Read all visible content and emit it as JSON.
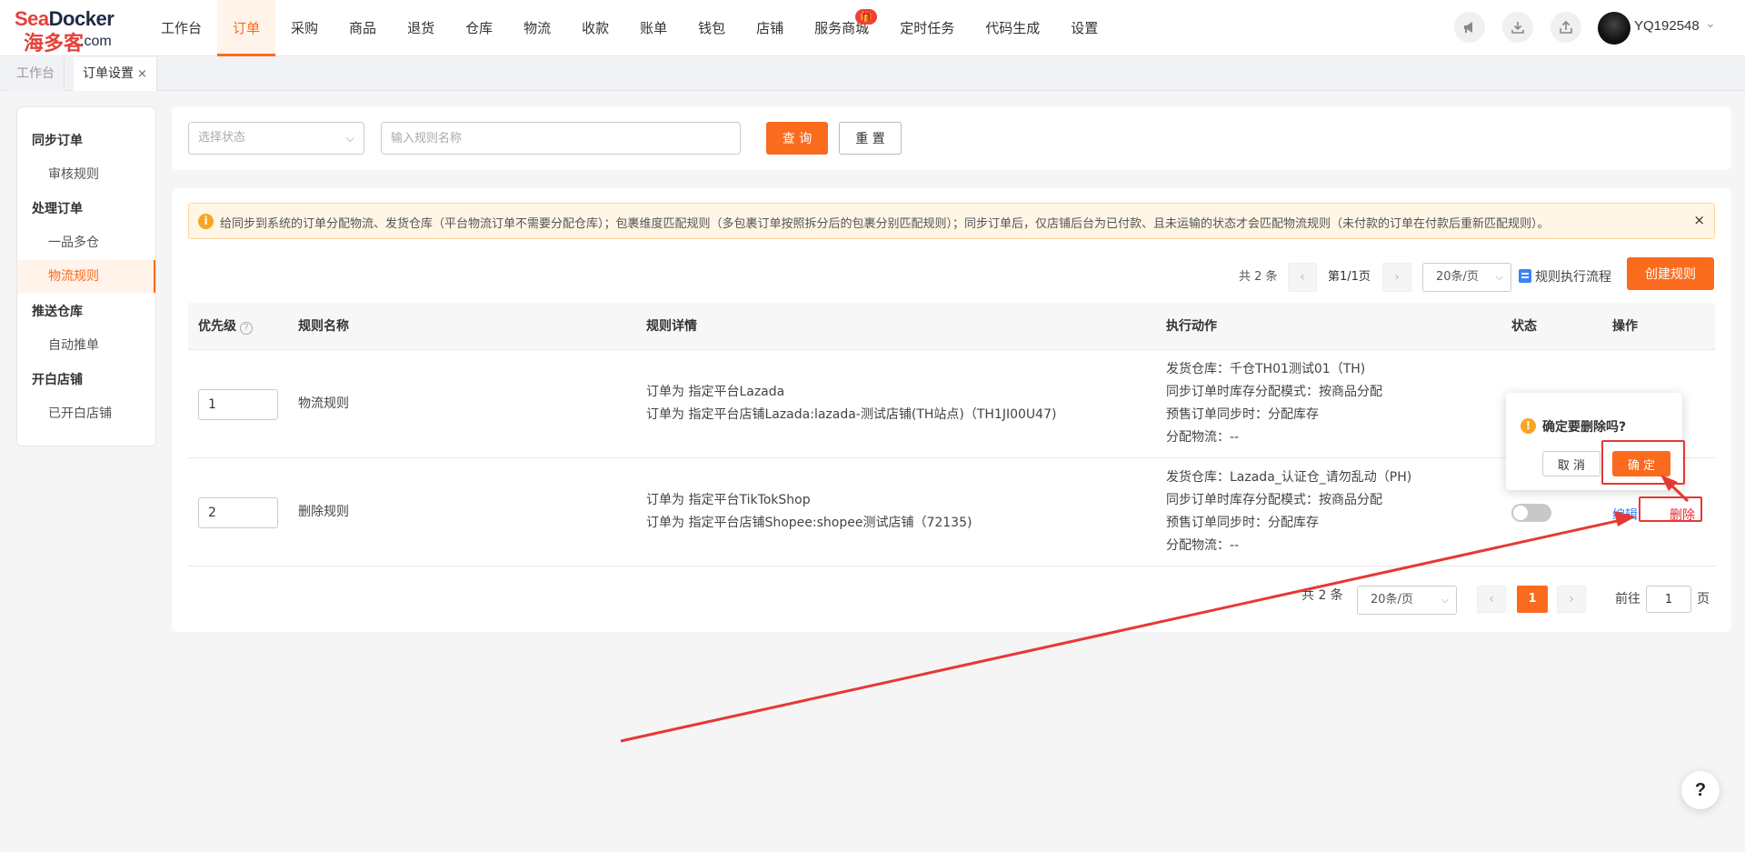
{
  "logo": {
    "en_part1": "Sea",
    "en_part2": "Docker",
    "cn": "海多客",
    "com": ".com"
  },
  "nav": {
    "items": [
      {
        "label": "工作台"
      },
      {
        "label": "订单",
        "active": true
      },
      {
        "label": "采购"
      },
      {
        "label": "商品"
      },
      {
        "label": "退货"
      },
      {
        "label": "仓库"
      },
      {
        "label": "物流"
      },
      {
        "label": "收款"
      },
      {
        "label": "账单"
      },
      {
        "label": "钱包"
      },
      {
        "label": "店铺"
      },
      {
        "label": "服务商城",
        "badge": "🎁"
      },
      {
        "label": "定时任务"
      },
      {
        "label": "代码生成"
      },
      {
        "label": "设置"
      }
    ],
    "accent_color": "#fa6b1e"
  },
  "header_icons": [
    "megaphone-icon",
    "download-icon",
    "share-icon"
  ],
  "user": {
    "name": "YQ192548",
    "caret": "⌄"
  },
  "page_tabs": [
    {
      "label": "工作台"
    },
    {
      "label": "订单设置",
      "close": "×"
    }
  ],
  "sidebar": {
    "groups": [
      {
        "title": "同步订单",
        "items": [
          {
            "label": "审核规则"
          }
        ]
      },
      {
        "title": "处理订单",
        "items": [
          {
            "label": "一品多仓"
          },
          {
            "label": "物流规则",
            "active": true
          }
        ]
      },
      {
        "title": "推送仓库",
        "items": [
          {
            "label": "自动推单"
          }
        ]
      },
      {
        "title": "开白店铺",
        "items": [
          {
            "label": "已开白店铺"
          }
        ]
      }
    ]
  },
  "filters": {
    "status_placeholder": "选择状态",
    "name_placeholder": "输入规则名称",
    "query_label": "查 询",
    "reset_label": "重 置"
  },
  "alert": {
    "icon": "i",
    "text": "给同步到系统的订单分配物流、发货仓库（平台物流订单不需要分配仓库）；包裹维度匹配规则（多包裹订单按照拆分后的包裹分别匹配规则）；同步订单后，仅店铺后台为已付款、且未运输的状态才会匹配物流规则（未付款的订单在付款后重新匹配规则）。",
    "close": "×"
  },
  "top_pagination": {
    "total": "共 2 条",
    "prev": "‹",
    "page": "第1/1页",
    "next": "›",
    "page_size": "20条/页",
    "flow_link": "规则执行流程",
    "create_label": "创建规则"
  },
  "table": {
    "headers": {
      "priority": "优先级",
      "priority_help": "?",
      "name": "规则名称",
      "detail": "规则详情",
      "action": "执行动作",
      "status": "状态",
      "ops": "操作"
    },
    "rows": [
      {
        "priority": "1",
        "name": "物流规则",
        "details": [
          "订单为 指定平台Lazada",
          "订单为 指定平台店铺Lazada:lazada-测试店铺(TH站点)（TH1JI00U47)"
        ],
        "actions": [
          "发货仓库：千仓TH01测试01（TH)",
          "同步订单时库存分配模式：按商品分配",
          "预售订单同步时：分配库存",
          "分配物流：--"
        ]
      },
      {
        "priority": "2",
        "name": "删除规则",
        "details": [
          "订单为 指定平台TikTokShop",
          "订单为 指定平台店铺Shopee:shopee测试店铺（72135)"
        ],
        "actions": [
          "发货仓库：Lazada_认证仓_请勿乱动（PH)",
          "同步订单时库存分配模式：按商品分配",
          "预售订单同步时：分配库存",
          "分配物流：--"
        ],
        "status_on": false,
        "edit_label": "编辑",
        "delete_label": "删除"
      }
    ]
  },
  "bottom_pagination": {
    "total": "共 2 条",
    "page_size": "20条/页",
    "prev": "‹",
    "current": "1",
    "next": "›",
    "goto_label": "前往",
    "goto_value": "1",
    "page_unit": "页"
  },
  "popconfirm": {
    "icon": "!",
    "message": "确定要删除吗?",
    "cancel_label": "取 消",
    "ok_label": "确 定"
  },
  "help_fab": "?",
  "annotation_color": "#e53935"
}
